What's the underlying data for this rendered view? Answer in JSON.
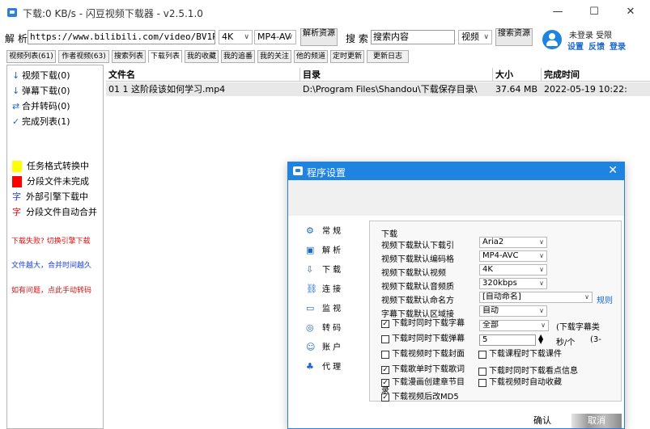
{
  "window": {
    "title": "下载:0 KB/s - 闪豆视频下载器 - v2.5.1.0",
    "minimize": "—",
    "maximize": "☐",
    "close": "✕"
  },
  "toolbar": {
    "parse_label": "解 析",
    "url_value": "https://www.bilibili.com/video/BV1PE4",
    "quality": "4K",
    "format": "MP4-AV",
    "parse_button": "解析资源",
    "search_label": "搜 索",
    "search_value": "搜索内容",
    "search_type": "视频",
    "search_button": "搜索资源",
    "user_status": "未登录 受限",
    "link_settings": "设置",
    "link_feedback": "反馈",
    "link_login": "登录"
  },
  "tabs": [
    "视频列表(61)",
    "作者视频(63)",
    "搜索列表",
    "下载列表",
    "我的收藏",
    "我的追番",
    "我的关注",
    "他的频道",
    "定时更新",
    "更新日志"
  ],
  "sidebar": {
    "items": [
      {
        "icon": "↓",
        "label": "视频下载(0)"
      },
      {
        "icon": "↓",
        "label": "弹幕下载(0)"
      },
      {
        "icon": "⇄",
        "label": "合并转码(0)"
      },
      {
        "icon": "✓",
        "label": "完成列表(1)"
      }
    ],
    "legend": [
      {
        "color": "#ffff00",
        "label": "任务格式转换中"
      },
      {
        "color": "#ff0000",
        "label": "分段文件未完成"
      },
      {
        "glyph": "字",
        "glyph_color": "#2040d0",
        "label": "外部引擎下载中"
      },
      {
        "glyph": "字",
        "glyph_color": "#e01010",
        "label": "分段文件自动合并"
      }
    ],
    "notes": [
      {
        "text": "下载失败? 切换引擎下载",
        "color": "red"
      },
      {
        "text": "文件越大，合并时间越久",
        "color": "blue"
      },
      {
        "text": "如有问题，点此手动转码",
        "color": "red"
      }
    ]
  },
  "table": {
    "headers": [
      "文件名",
      "目录",
      "大小",
      "完成时间"
    ],
    "rows": [
      [
        "01 1 这阶段该如何学习.mp4",
        "D:\\Program Files\\Shandou\\下载保存目录\\",
        "37.64 MB",
        "2022-05-19 10:22:"
      ]
    ]
  },
  "dialog": {
    "title": "程序设置",
    "close": "✕",
    "nav": [
      {
        "icon": "⚙",
        "label": "常 规"
      },
      {
        "icon": "▣",
        "label": "解 析"
      },
      {
        "icon": "⇩",
        "label": "下 载"
      },
      {
        "icon": "⛓",
        "label": "连 接"
      },
      {
        "icon": "▭",
        "label": "监 视"
      },
      {
        "icon": "◎",
        "label": "转 码"
      },
      {
        "icon": "☺",
        "label": "账 户"
      },
      {
        "icon": "♣",
        "label": "代 理"
      }
    ],
    "group": "下载",
    "rows": [
      {
        "label": "视频下载默认下载引",
        "value": "Aria2"
      },
      {
        "label": "视频下载默认编码格",
        "value": "MP4-AVC"
      },
      {
        "label": "视频下载默认视频",
        "value": "4K"
      },
      {
        "label": "视频下载默认音频质",
        "value": "320kbps"
      },
      {
        "label": "视频下载默认命名方",
        "value": "[自动命名]"
      },
      {
        "label": "字幕下载默认区域接",
        "value": "自动"
      }
    ],
    "rule_link": "规则",
    "checks_left": [
      {
        "label": "下载时同时下载字幕",
        "checked": true
      },
      {
        "label": "下载时同时下载弹幕",
        "checked": false
      },
      {
        "label": "下载视频时下载封面",
        "checked": false
      },
      {
        "label": "下载歌单时下载歌词",
        "checked": true
      },
      {
        "label": "下载漫画创建章节目录",
        "checked": true
      },
      {
        "label": "下载视频后改MD5",
        "checked": true
      }
    ],
    "subtitle_select": "全部",
    "subtitle_note": "(下载字幕类",
    "speed_value": "5",
    "speed_unit": "秒/个",
    "speed_note": "(3-",
    "checks_right": [
      {
        "label": "下载课程时下载课件",
        "checked": false
      },
      {
        "label": "下载时同时下载看点信息",
        "checked": false
      },
      {
        "label": "下载视频时自动收藏",
        "checked": false
      }
    ],
    "ok": "确认",
    "cancel": "取消"
  }
}
